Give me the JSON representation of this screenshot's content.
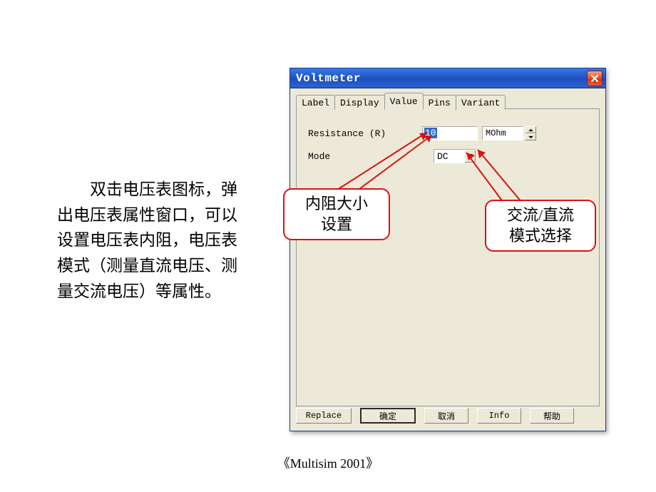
{
  "description": "双击电压表图标，弹出电压表属性窗口，可以设置电压表内阻，电压表模式（测量直流电压、测量交流电压）等属性。",
  "footer": "《Multisim 2001》",
  "dialog": {
    "title": "Voltmeter",
    "tabs": {
      "label": "Label",
      "display": "Display",
      "value": "Value",
      "pins": "Pins",
      "variant": "Variant",
      "active": "value"
    },
    "fields": {
      "resistance_label": "Resistance (R)",
      "resistance_value": "10",
      "resistance_unit": "MOhm",
      "mode_label": "Mode",
      "mode_value": "DC"
    },
    "buttons": {
      "replace": "Replace",
      "ok": "确定",
      "cancel": "取消",
      "info": "Info",
      "help": "帮助"
    }
  },
  "callouts": {
    "c1_line1": "内阻大小",
    "c1_line2": "设置",
    "c2_line1": "交流/直流",
    "c2_line2": "模式选择"
  }
}
